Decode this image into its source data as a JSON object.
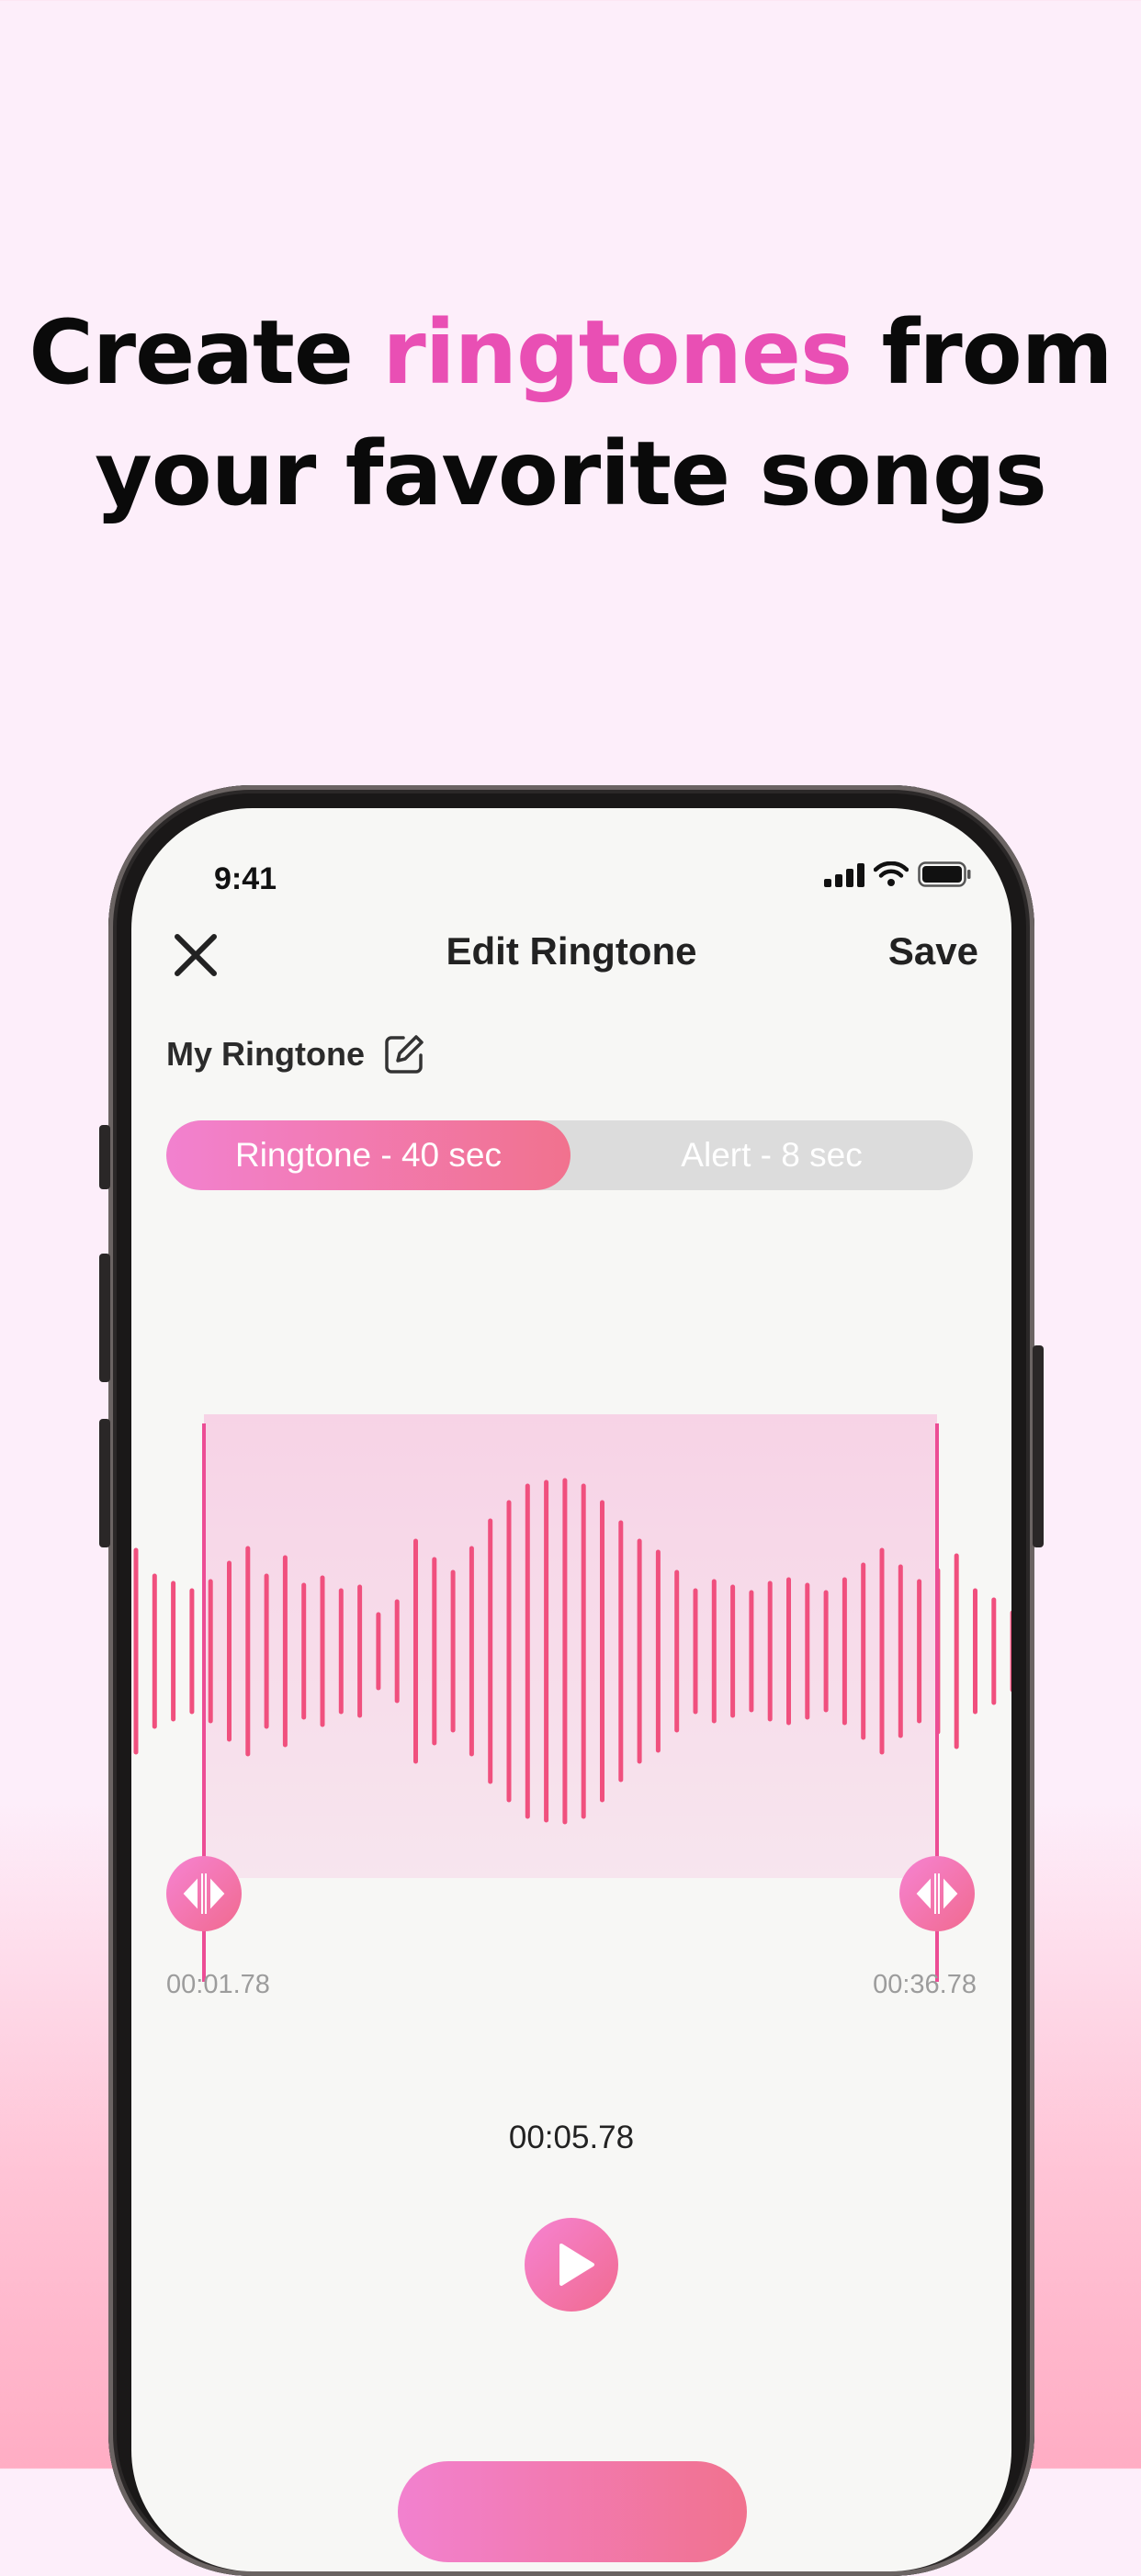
{
  "headline": {
    "pre": "Create ",
    "accent": "ringtones",
    "post": " from",
    "line2": "your favorite songs"
  },
  "status_bar": {
    "time": "9:41"
  },
  "nav": {
    "title": "Edit Ringtone",
    "save_label": "Save"
  },
  "ringtone_name": "My Ringtone",
  "segmented": {
    "options": [
      "Ringtone - 40 sec",
      "Alert - 8 sec"
    ],
    "selected": "Ringtone - 40 sec"
  },
  "trim": {
    "start_time": "00:01.78",
    "end_time": "00:36.78",
    "current_time": "00:05.78"
  },
  "icons": {
    "close": "close-icon",
    "edit": "edit-pencil-icon",
    "play": "play-icon",
    "handle": "left-right-arrows-icon"
  },
  "colors": {
    "accent_pink": "#e94fb4",
    "waveform": "#f0507e",
    "gradient_start": "#f281cf",
    "gradient_end": "#f1728e"
  }
}
